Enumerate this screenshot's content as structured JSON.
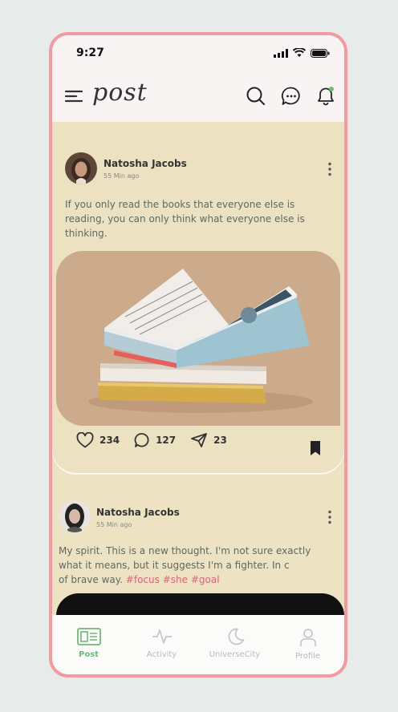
{
  "status_bar": {
    "time": "9:27"
  },
  "header": {
    "logo": "post"
  },
  "posts": [
    {
      "author": "Natosha Jacobs",
      "time_ago": "55 Min ago",
      "text": "If you only read the books that everyone else is reading, you can only think what everyone else is thinking.",
      "likes": "234",
      "comments": "127",
      "shares": "23"
    },
    {
      "author": "Natosha Jacobs",
      "time_ago": "55 Min ago",
      "text_lines": [
        "My spirit. This is a new thought. I'm not sure exactly",
        "what it means, but it suggests I'm a fighter. In c",
        "of brave way."
      ],
      "tags": [
        "#focus",
        "#she",
        "#goal"
      ]
    }
  ],
  "tabs": [
    {
      "label": "Post",
      "icon": "post-card-icon",
      "active": true
    },
    {
      "label": "Activity",
      "icon": "activity-icon",
      "active": false
    },
    {
      "label": "UniverseCity",
      "icon": "moon-icon",
      "active": false
    },
    {
      "label": "Profile",
      "icon": "profile-icon",
      "active": false
    }
  ],
  "colors": {
    "accent": "#74b777",
    "frame": "#f29aa3",
    "card": "#ece1c0",
    "tag": "#d86576"
  }
}
